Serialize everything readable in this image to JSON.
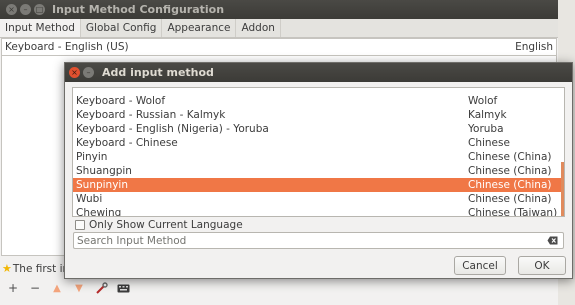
{
  "main_window": {
    "title": "Input Method Configuration",
    "tabs": [
      "Input Method",
      "Global Config",
      "Appearance",
      "Addon"
    ],
    "current_im": {
      "name": "Keyboard - English (US)",
      "language": "English"
    },
    "hint": "The first inp",
    "toolbar_icons": [
      "plus-icon",
      "minus-icon",
      "arrow-up-icon",
      "arrow-down-icon",
      "configure-icon",
      "keyboard-icon"
    ]
  },
  "dialog": {
    "title": "Add input method",
    "items": [
      {
        "name": "",
        "language": ""
      },
      {
        "name": "Keyboard - Wolof",
        "language": "Wolof"
      },
      {
        "name": "Keyboard - Russian - Kalmyk",
        "language": "Kalmyk"
      },
      {
        "name": "Keyboard - English (Nigeria) - Yoruba",
        "language": "Yoruba"
      },
      {
        "name": "Keyboard - Chinese",
        "language": "Chinese"
      },
      {
        "name": "Pinyin",
        "language": "Chinese (China)"
      },
      {
        "name": "Shuangpin",
        "language": "Chinese (China)"
      },
      {
        "name": "Sunpinyin",
        "language": "Chinese (China)"
      },
      {
        "name": "Wubi",
        "language": "Chinese (China)"
      },
      {
        "name": "Chewing",
        "language": "Chinese (Taiwan)"
      }
    ],
    "selected_index": 7,
    "only_show_label": "Only Show Current Language",
    "only_show_checked": false,
    "search_placeholder": "Search Input Method",
    "cancel_label": "Cancel",
    "ok_label": "OK"
  },
  "colors": {
    "selection": "#f07746",
    "titlebar": "#3c3b37",
    "close_button": "#e0502f"
  }
}
